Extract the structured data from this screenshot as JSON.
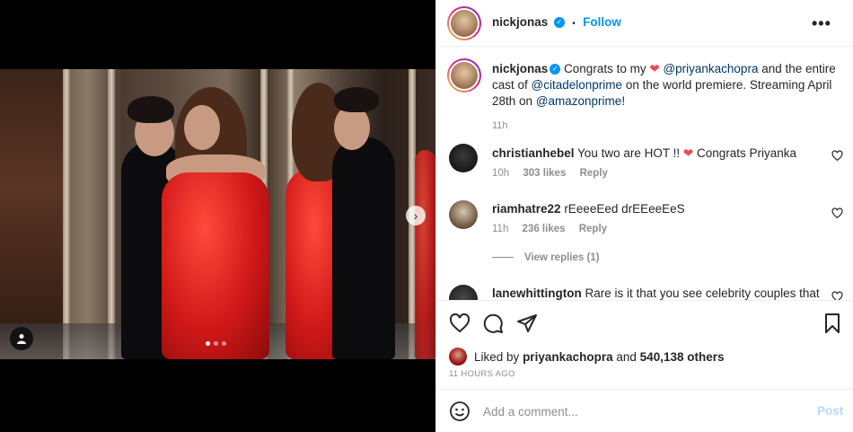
{
  "post": {
    "username": "nickjonas",
    "follow_label": "Follow",
    "separator": "•",
    "more_label": "•••",
    "carousel": {
      "total": 3,
      "active": 1
    }
  },
  "caption": {
    "username": "nickjonas",
    "text_before": "Congrats to my",
    "mention1": "@priyankachopra",
    "text_mid1": "and the entire cast of",
    "mention2": "@citadelonprime",
    "text_mid2": "on the world premiere. Streaming April 28th on",
    "mention3": "@amazonprime",
    "text_end": "!",
    "time": "11h"
  },
  "comments": [
    {
      "username": "christianhebel",
      "text_before": "You two are HOT !!",
      "text_after": "Congrats Priyanka",
      "time": "10h",
      "likes": "303 likes",
      "reply": "Reply"
    },
    {
      "username": "riamhatre22",
      "text": "rEeeeEed drEEeeEeS",
      "time": "11h",
      "likes": "236 likes",
      "reply": "Reply"
    },
    {
      "username": "lanewhittington",
      "text": "Rare is it that you see celebrity couples that"
    }
  ],
  "view_replies": "View replies (1)",
  "likes": {
    "prefix": "Liked by",
    "user": "priyankachopra",
    "middle": "and",
    "count": "540,138 others"
  },
  "posted_ago": "11 HOURS AGO",
  "add_comment": {
    "placeholder": "Add a comment...",
    "post_label": "Post"
  },
  "icons": {
    "heart": "heart-icon",
    "comment": "comment-icon",
    "share": "share-icon",
    "save": "bookmark-icon",
    "emoji": "emoji-icon",
    "next": "chevron-right-icon",
    "tag": "user-tag-icon"
  },
  "colors": {
    "accent": "#0095f6",
    "mention": "#00376b",
    "heart": "#ed4956",
    "muted": "#8e8e8e",
    "post_disabled": "#b3dbff"
  }
}
